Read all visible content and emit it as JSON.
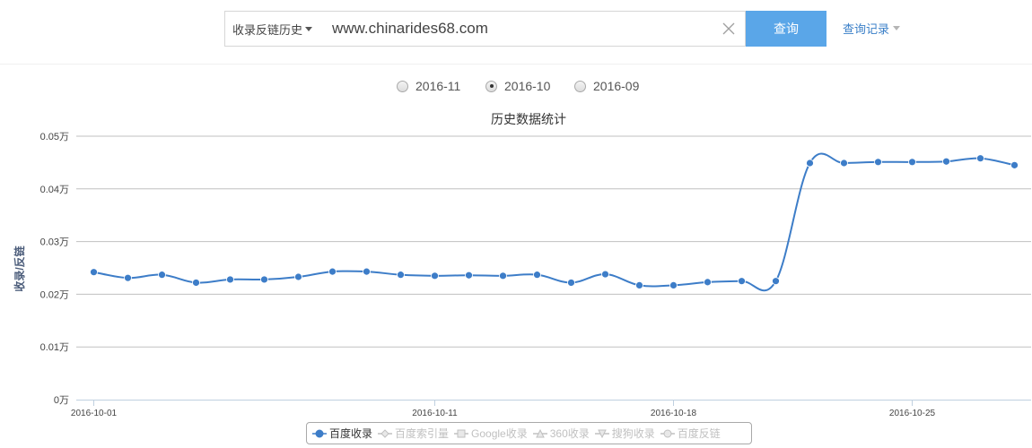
{
  "search": {
    "type_label": "收录反链历史",
    "url_value": "www.chinarides68.com",
    "query_label": "查询",
    "history_label": "查询记录"
  },
  "months": [
    {
      "label": "2016-11",
      "checked": false
    },
    {
      "label": "2016-10",
      "checked": true
    },
    {
      "label": "2016-09",
      "checked": false
    }
  ],
  "colors": {
    "series": "#3d7dc8",
    "accent": "#5aa6e8",
    "grid": "#c0c0c0",
    "axis": "#c0d0e0"
  },
  "chart_data": {
    "type": "line",
    "title": "历史数据统计",
    "ylabel": "收录/反链",
    "ylim": [
      0,
      0.05
    ],
    "yticks": [
      {
        "value": 0,
        "label": "0万"
      },
      {
        "value": 0.01,
        "label": "0.01万"
      },
      {
        "value": 0.02,
        "label": "0.02万"
      },
      {
        "value": 0.03,
        "label": "0.03万"
      },
      {
        "value": 0.04,
        "label": "0.04万"
      },
      {
        "value": 0.05,
        "label": "0.05万"
      }
    ],
    "x_start": "2016-10-01",
    "x_end": "2016-10-28",
    "xticks": [
      "2016-10-01",
      "2016-10-11",
      "2016-10-18",
      "2016-10-25"
    ],
    "legend": [
      {
        "name": "百度收录",
        "symbol": "circle",
        "active": true
      },
      {
        "name": "百度索引量",
        "symbol": "diamond",
        "active": false
      },
      {
        "name": "Google收录",
        "symbol": "square",
        "active": false
      },
      {
        "name": "360收录",
        "symbol": "triangle",
        "active": false
      },
      {
        "name": "搜狗收录",
        "symbol": "triangle-down",
        "active": false
      },
      {
        "name": "百度反链",
        "symbol": "circle",
        "active": false
      }
    ],
    "series": [
      {
        "name": "百度收录",
        "x": [
          "2016-10-01",
          "2016-10-02",
          "2016-10-03",
          "2016-10-04",
          "2016-10-05",
          "2016-10-06",
          "2016-10-07",
          "2016-10-08",
          "2016-10-09",
          "2016-10-10",
          "2016-10-11",
          "2016-10-12",
          "2016-10-13",
          "2016-10-14",
          "2016-10-15",
          "2016-10-16",
          "2016-10-17",
          "2016-10-18",
          "2016-10-19",
          "2016-10-20",
          "2016-10-21",
          "2016-10-22",
          "2016-10-23",
          "2016-10-24",
          "2016-10-25",
          "2016-10-26",
          "2016-10-27",
          "2016-10-28"
        ],
        "values": [
          0.0242,
          0.0231,
          0.0237,
          0.0222,
          0.0228,
          0.0228,
          0.0233,
          0.0243,
          0.0243,
          0.0237,
          0.0235,
          0.0236,
          0.0235,
          0.0237,
          0.0222,
          0.0238,
          0.0217,
          0.0217,
          0.0223,
          0.0225,
          0.0225,
          0.0449,
          0.0449,
          0.0451,
          0.0451,
          0.0452,
          0.0458,
          0.0445
        ]
      }
    ]
  }
}
